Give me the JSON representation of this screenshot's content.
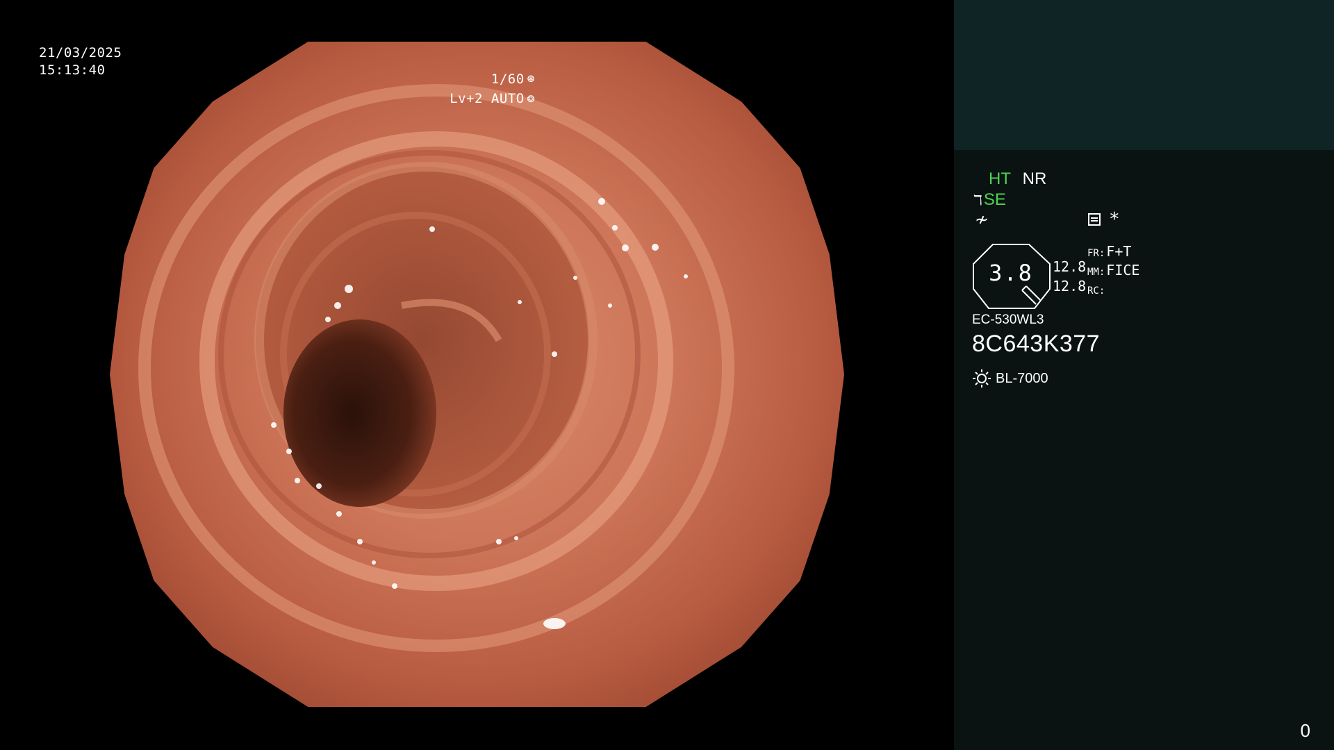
{
  "overlay": {
    "date": "21/03/2025",
    "time": "15:13:40",
    "shutter": "1/60",
    "shutter_icon": "shutter-icon",
    "iris_mode": "Lv+2 AUTO",
    "iris_icon": "iris-icon"
  },
  "panel": {
    "ht_label": "HT",
    "nr_label": "NR",
    "se_label": "SE",
    "se_icon": "structure-enhance-icon",
    "slash_icon": "color-mode-icon",
    "doc_icon": "document-icon",
    "asterisk": "*",
    "zoom_value": "3.8",
    "num1": "12.8",
    "num2": "12.8",
    "fr_label": "FR:",
    "fr_value": "F+T",
    "mm_label": "MM:",
    "mm_value": "FICE",
    "rc_label": "RC:",
    "rc_value": "",
    "model": "EC-530WL3",
    "serial": "8C643K377",
    "light_icon": "light-source-icon",
    "light_source": "BL-7000",
    "frame_counter": "0"
  },
  "colors": {
    "accent_green": "#4fd34f",
    "panel_top": "#0e2425",
    "panel_body": "#0a1312",
    "mucosa": "#cd7558"
  }
}
